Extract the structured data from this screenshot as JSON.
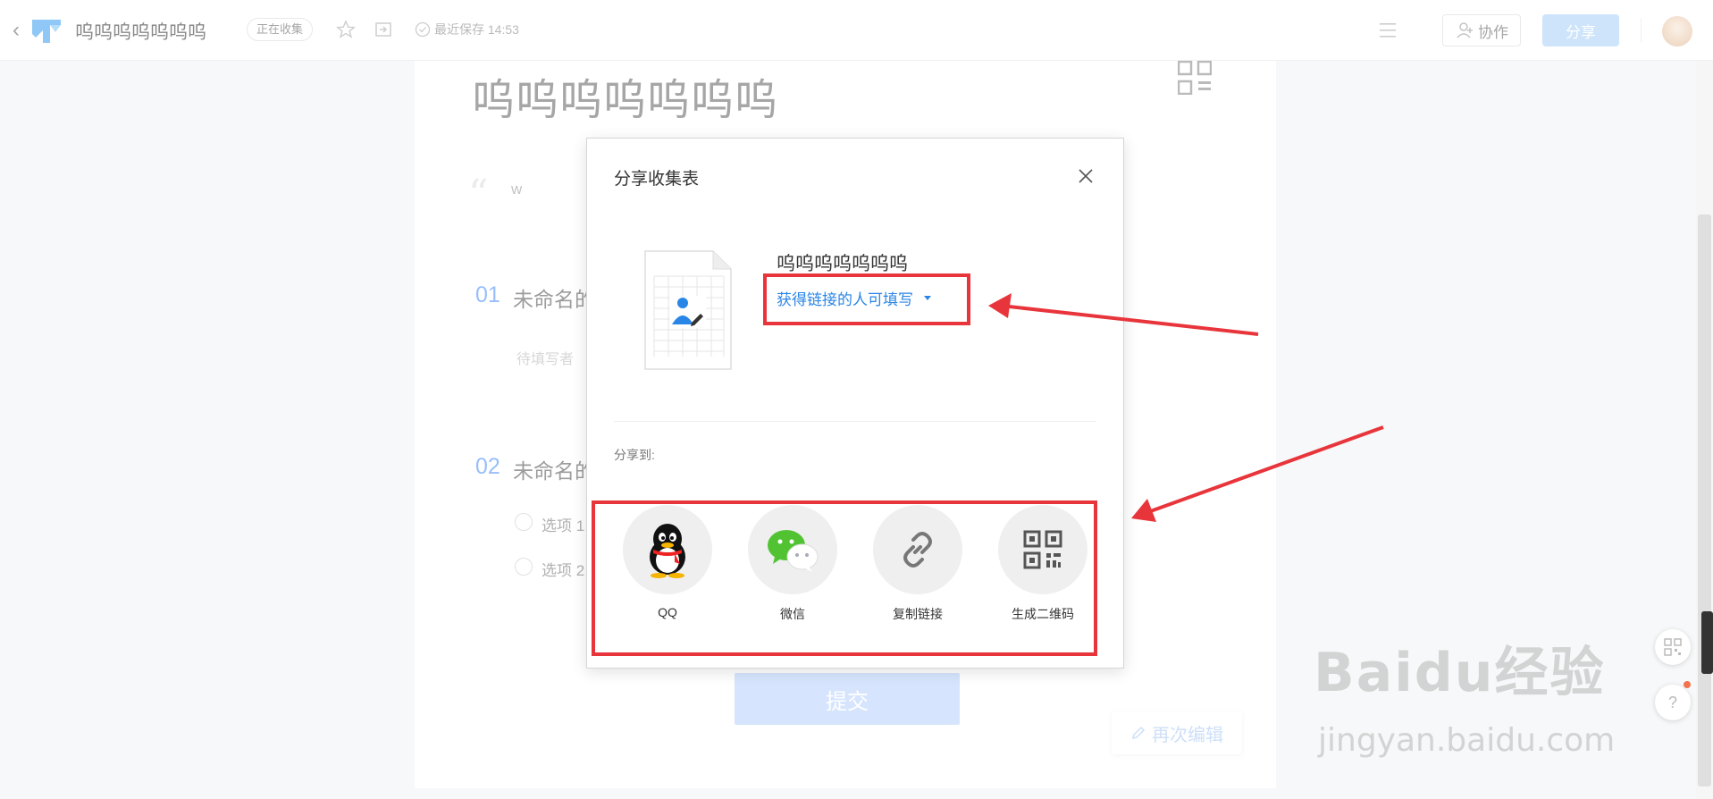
{
  "topbar": {
    "title": "呜呜呜呜呜呜呜",
    "status_badge": "正在收集",
    "save_status": "最近保存 14:53",
    "collab_label": "协作",
    "share_label": "分享"
  },
  "form": {
    "title": "呜呜呜呜呜呜呜",
    "description": "w",
    "questions": [
      {
        "num": "01",
        "title": "未命名的",
        "placeholder": "待填写者"
      },
      {
        "num": "02",
        "title": "未命名的",
        "options": [
          "选项 1",
          "选项 2"
        ]
      }
    ],
    "submit_label": "提交",
    "reedit_label": "再次编辑"
  },
  "modal": {
    "title": "分享收集表",
    "file_name": "呜呜呜呜呜呜呜",
    "permission": "获得链接的人可填写",
    "share_to_label": "分享到:",
    "share_options": [
      {
        "label": "QQ",
        "icon": "qq-penguin-icon"
      },
      {
        "label": "微信",
        "icon": "wechat-icon"
      },
      {
        "label": "复制链接",
        "icon": "link-icon"
      },
      {
        "label": "生成二维码",
        "icon": "qrcode-icon"
      }
    ]
  },
  "watermark": {
    "brand": "Baidu经验",
    "url": "jingyan.baidu.com"
  },
  "colors": {
    "accent": "#2a86e6",
    "annotation": "#e8353b",
    "share_button": "#a9d1f7"
  }
}
